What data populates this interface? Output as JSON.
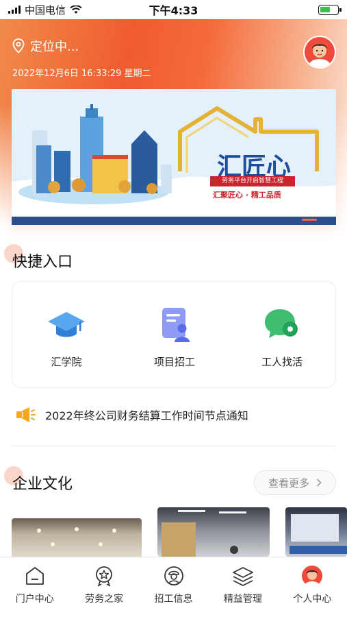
{
  "status_bar": {
    "carrier": "中国电信",
    "time": "下午4:33"
  },
  "header": {
    "location": "定位中...",
    "datetime": "2022年12月6日 16:33:29   星期二"
  },
  "banner": {
    "title": "汇匠心",
    "ribbon": "劳务平台开启智慧工程",
    "subtitle": "汇聚匠心 · 精工品质"
  },
  "quick_entry": {
    "title": "快捷入口",
    "items": [
      {
        "label": "汇学院",
        "icon": "graduation-cap-icon"
      },
      {
        "label": "项目招工",
        "icon": "recruit-document-icon"
      },
      {
        "label": "工人找活",
        "icon": "chat-bubble-icon"
      }
    ]
  },
  "notice": {
    "text": "2022年终公司财务结算工作时间节点通知",
    "icon": "megaphone-icon"
  },
  "culture": {
    "title": "企业文化",
    "more_label": "查看更多"
  },
  "tabs": [
    {
      "label": "门户中心",
      "icon": "home-icon"
    },
    {
      "label": "劳务之家",
      "icon": "star-badge-icon"
    },
    {
      "label": "招工信息",
      "icon": "worker-icon"
    },
    {
      "label": "精益管理",
      "icon": "layers-icon"
    },
    {
      "label": "个人中心",
      "icon": "avatar-icon"
    }
  ],
  "colors": {
    "accent": "#f05c2e",
    "brand_blue": "#1d4e9e",
    "notice_orange": "#f5a623"
  }
}
